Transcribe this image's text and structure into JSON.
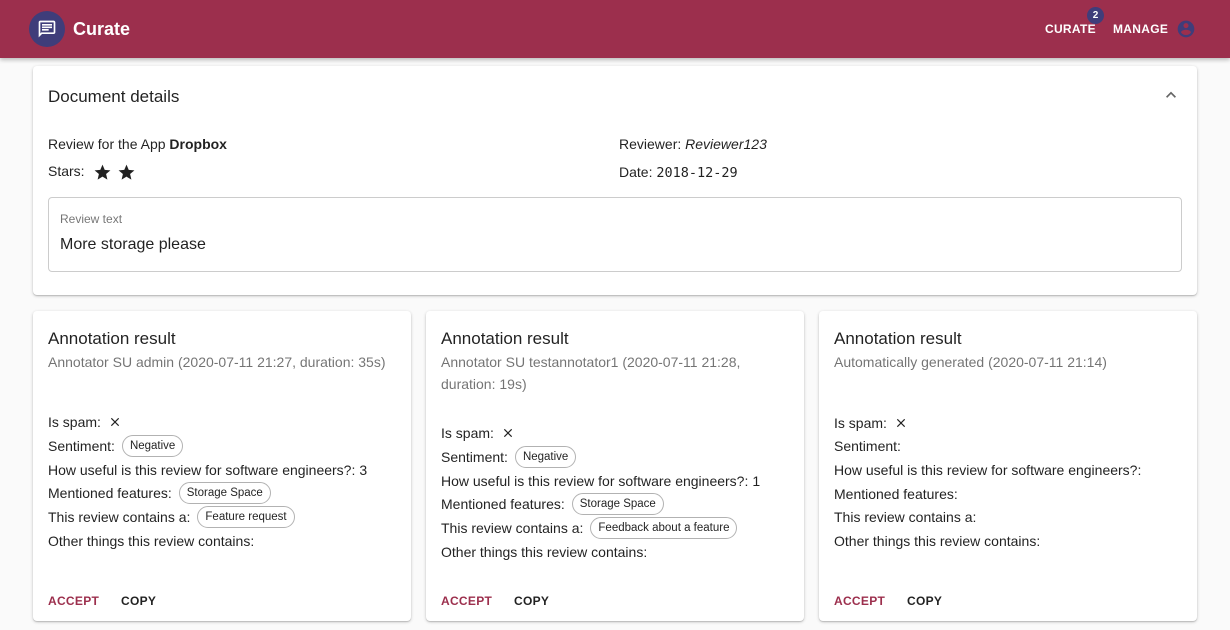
{
  "appbar": {
    "title": "Curate",
    "nav_curate": "CURATE",
    "curate_badge": "2",
    "nav_manage": "MANAGE"
  },
  "document": {
    "title": "Document details",
    "app_prefix": "Review for the App",
    "app_name": "Dropbox",
    "stars_label": "Stars:",
    "stars_count": 2,
    "reviewer_label": "Reviewer:",
    "reviewer_name": "Reviewer123",
    "date_label": "Date:",
    "date_value": "2018-12-29",
    "review_text_label": "Review text",
    "review_text": "More storage please"
  },
  "labels": {
    "is_spam": "Is spam:",
    "sentiment": "Sentiment:",
    "useful": "How useful is this review for software engineers?:",
    "features": "Mentioned features:",
    "contains": "This review contains a:",
    "other": "Other things this review contains:",
    "accept": "ACCEPT",
    "copy": "COPY"
  },
  "annotations": [
    {
      "title": "Annotation result",
      "subtitle": "Annotator SU admin (2020-07-11 21:27, duration: 35s)",
      "sentiment": "Negative",
      "useful_value": "3",
      "feature": "Storage Space",
      "contains": "Feature request"
    },
    {
      "title": "Annotation result",
      "subtitle": "Annotator SU testannotator1 (2020-07-11 21:28, duration: 19s)",
      "sentiment": "Negative",
      "useful_value": "1",
      "feature": "Storage Space",
      "contains": "Feedback about a feature"
    },
    {
      "title": "Annotation result",
      "subtitle": "Automatically generated (2020-07-11 21:14)",
      "sentiment": "",
      "useful_value": "",
      "feature": "",
      "contains": ""
    }
  ],
  "colors": {
    "primary": "#9c2f4d",
    "secondary": "#3f3d7a"
  },
  "icons": {
    "logo": "chat-bubble-icon",
    "avatar": "account-circle-icon",
    "collapse": "chevron-up-icon",
    "spam_false": "close-icon",
    "star": "star-icon"
  }
}
